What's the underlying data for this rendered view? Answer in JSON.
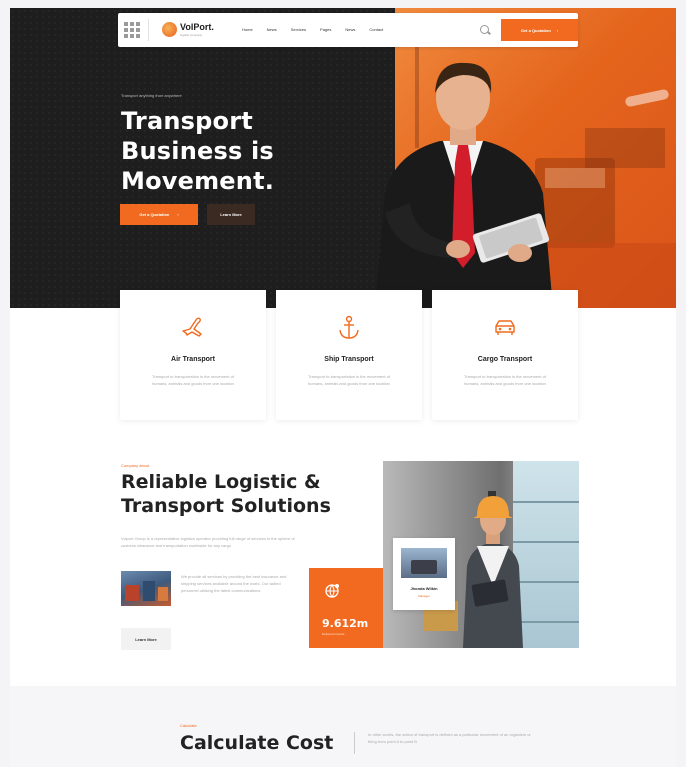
{
  "nav": {
    "logo_text": "VolPort.",
    "logo_tagline": "logistic company",
    "menu": [
      "Home",
      "News",
      "Services",
      "Pages",
      "News",
      "Contact"
    ],
    "quote_button": "Get a Quotation"
  },
  "hero": {
    "eyebrow": "Transport anything from anywhere",
    "title_lines": [
      "Transport",
      "Business is",
      "Movement."
    ],
    "primary_button": "Get a Quotation",
    "secondary_button": "Learn More"
  },
  "services": [
    {
      "icon": "airplane-icon",
      "title": "Air Transport",
      "desc": "Transport to transportation is the movement of humans, animals and goods from one location"
    },
    {
      "icon": "anchor-icon",
      "title": "Ship Transport",
      "desc": "Transport to transportation is the movement of humans, animals and goods from one location"
    },
    {
      "icon": "car-icon",
      "title": "Cargo Transport",
      "desc": "Transport to transportation is the movement of humans, animals and goods from one location"
    }
  ],
  "about": {
    "eyebrow": "Company about",
    "title_lines": [
      "Reliable Logistic &",
      "Transport Solutions"
    ],
    "paragraph": "Volport Group is a representative logistics operator providing full range of services in the sphere of customs clearance and transportation worldwide for any cargo",
    "thumb_text": "We provide all services by providing the best insurance and shipping services available around the world. Our skilled personnel utilising the latest communications",
    "learn_button": "Learn More",
    "profile": {
      "name": "Jhonda Wilkin",
      "role": "Manager"
    },
    "stat": {
      "value": "9.612m",
      "label": "Delivered Goods"
    }
  },
  "calculate": {
    "eyebrow": "Calculate",
    "title": "Calculate Cost",
    "desc": "In other words, the action of transport is defined as a particular movement of an organism or thing from point A to point B"
  },
  "colors": {
    "accent": "#f16a1f",
    "dark": "#1e1e1e"
  }
}
